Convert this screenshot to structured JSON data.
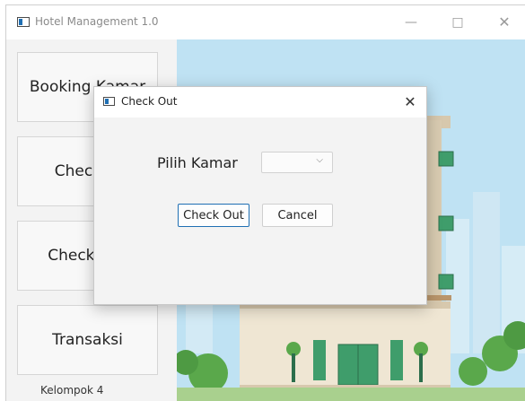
{
  "window": {
    "title": "Hotel Management 1.0",
    "minimize": "—",
    "maximize": "□",
    "close": "✕"
  },
  "sidebar": {
    "items": [
      {
        "label": "Booking Kamar"
      },
      {
        "label": "Check In"
      },
      {
        "label": "Check Out"
      },
      {
        "label": "Transaksi"
      }
    ],
    "footer": "Kelompok 4"
  },
  "dialog": {
    "title": "Check Out",
    "close": "✕",
    "field_label": "Pilih Kamar",
    "combo_value": "",
    "combo_arrow": "⌵",
    "checkout_button": "Check Out",
    "cancel_button": "Cancel"
  },
  "colors": {
    "accent": "#1f6fb3",
    "sky": "#bfe2f3",
    "building": "#e8dcc6",
    "trees": "#5aa84b"
  }
}
